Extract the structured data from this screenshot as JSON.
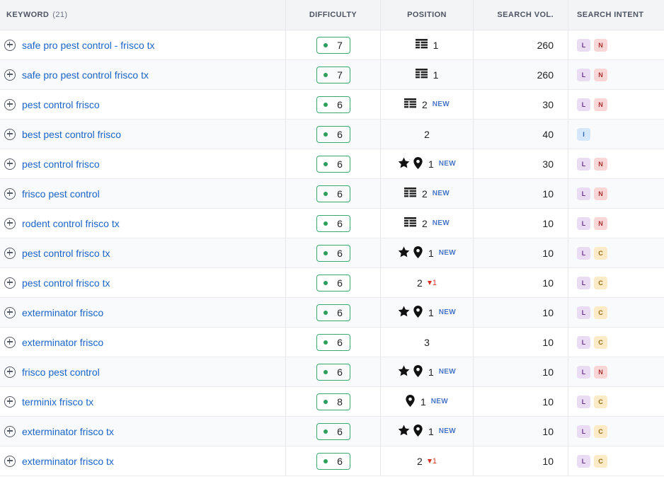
{
  "header": {
    "keyword_label": "KEYWORD",
    "keyword_count": "(21)",
    "difficulty_label": "DIFFICULTY",
    "position_label": "POSITION",
    "volume_label": "SEARCH VOL.",
    "intent_label": "SEARCH INTENT"
  },
  "rows": [
    {
      "keyword": "safe pro pest control - frisco tx",
      "difficulty": "7",
      "icons": [
        "list-icon"
      ],
      "position": "1",
      "new": "",
      "delta": "",
      "volume": "260",
      "intent": [
        "L",
        "N"
      ]
    },
    {
      "keyword": "safe pro pest control frisco tx",
      "difficulty": "7",
      "icons": [
        "list-icon"
      ],
      "position": "1",
      "new": "",
      "delta": "",
      "volume": "260",
      "intent": [
        "L",
        "N"
      ]
    },
    {
      "keyword": "pest control frisco",
      "difficulty": "6",
      "icons": [
        "list-icon"
      ],
      "position": "2",
      "new": "NEW",
      "delta": "",
      "volume": "30",
      "intent": [
        "L",
        "N"
      ]
    },
    {
      "keyword": "best pest control frisco",
      "difficulty": "6",
      "icons": [],
      "position": "2",
      "new": "",
      "delta": "",
      "volume": "40",
      "intent": [
        "I"
      ]
    },
    {
      "keyword": "pest control frisco",
      "difficulty": "6",
      "icons": [
        "star-icon",
        "pin-icon"
      ],
      "position": "1",
      "new": "NEW",
      "delta": "",
      "volume": "30",
      "intent": [
        "L",
        "N"
      ]
    },
    {
      "keyword": "frisco pest control",
      "difficulty": "6",
      "icons": [
        "list-icon"
      ],
      "position": "2",
      "new": "NEW",
      "delta": "",
      "volume": "10",
      "intent": [
        "L",
        "N"
      ]
    },
    {
      "keyword": "rodent control frisco tx",
      "difficulty": "6",
      "icons": [
        "list-icon"
      ],
      "position": "2",
      "new": "NEW",
      "delta": "",
      "volume": "10",
      "intent": [
        "L",
        "N"
      ]
    },
    {
      "keyword": "pest control frisco tx",
      "difficulty": "6",
      "icons": [
        "star-icon",
        "pin-icon"
      ],
      "position": "1",
      "new": "NEW",
      "delta": "",
      "volume": "10",
      "intent": [
        "L",
        "C"
      ]
    },
    {
      "keyword": "pest control frisco tx",
      "difficulty": "6",
      "icons": [],
      "position": "2",
      "new": "",
      "delta": "1",
      "volume": "10",
      "intent": [
        "L",
        "C"
      ]
    },
    {
      "keyword": "exterminator frisco",
      "difficulty": "6",
      "icons": [
        "star-icon",
        "pin-icon"
      ],
      "position": "1",
      "new": "NEW",
      "delta": "",
      "volume": "10",
      "intent": [
        "L",
        "C"
      ]
    },
    {
      "keyword": "exterminator frisco",
      "difficulty": "6",
      "icons": [],
      "position": "3",
      "new": "",
      "delta": "",
      "volume": "10",
      "intent": [
        "L",
        "C"
      ]
    },
    {
      "keyword": "frisco pest control",
      "difficulty": "6",
      "icons": [
        "star-icon",
        "pin-icon"
      ],
      "position": "1",
      "new": "NEW",
      "delta": "",
      "volume": "10",
      "intent": [
        "L",
        "N"
      ]
    },
    {
      "keyword": "terminix frisco tx",
      "difficulty": "8",
      "icons": [
        "pin-icon"
      ],
      "position": "1",
      "new": "NEW",
      "delta": "",
      "volume": "10",
      "intent": [
        "L",
        "C"
      ]
    },
    {
      "keyword": "exterminator frisco tx",
      "difficulty": "6",
      "icons": [
        "star-icon",
        "pin-icon"
      ],
      "position": "1",
      "new": "NEW",
      "delta": "",
      "volume": "10",
      "intent": [
        "L",
        "C"
      ]
    },
    {
      "keyword": "exterminator frisco tx",
      "difficulty": "6",
      "icons": [],
      "position": "2",
      "new": "",
      "delta": "1",
      "volume": "10",
      "intent": [
        "L",
        "C"
      ]
    }
  ],
  "colors": {
    "link": "#1b64c9",
    "difficulty_border": "#3aa86b",
    "new_tag": "#4876c7",
    "delta_down": "#d93025"
  }
}
